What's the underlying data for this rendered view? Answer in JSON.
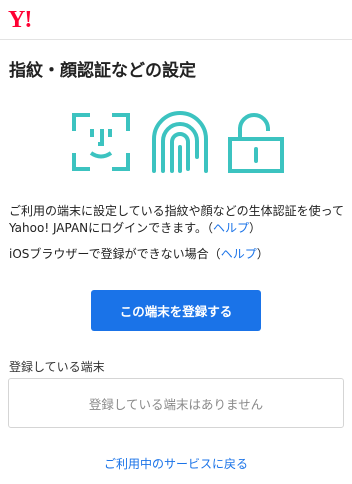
{
  "header": {
    "logo_text": "Y!",
    "brand_color": "#ff0033"
  },
  "page": {
    "title": "指紋・顔認証などの設定"
  },
  "icons": {
    "items": [
      "face-scan-icon",
      "fingerprint-icon",
      "padlock-icon"
    ],
    "color": "#3cc3c0"
  },
  "description": {
    "text": "ご利用の端末に設定している指紋や顔などの生体認証を使ってYahoo! JAPANにログインできます。（",
    "help_link": "ヘルプ",
    "text_end": "）"
  },
  "ios_note": {
    "text": "iOSブラウザーで登録ができない場合（",
    "help_link": "ヘルプ",
    "text_end": "）"
  },
  "register_button": {
    "label": "この端末を登録する",
    "color": "#1a73e8"
  },
  "registered_devices": {
    "label": "登録している端末",
    "empty_message": "登録している端末はありません"
  },
  "footer": {
    "back_link": "ご利用中のサービスに戻る"
  }
}
